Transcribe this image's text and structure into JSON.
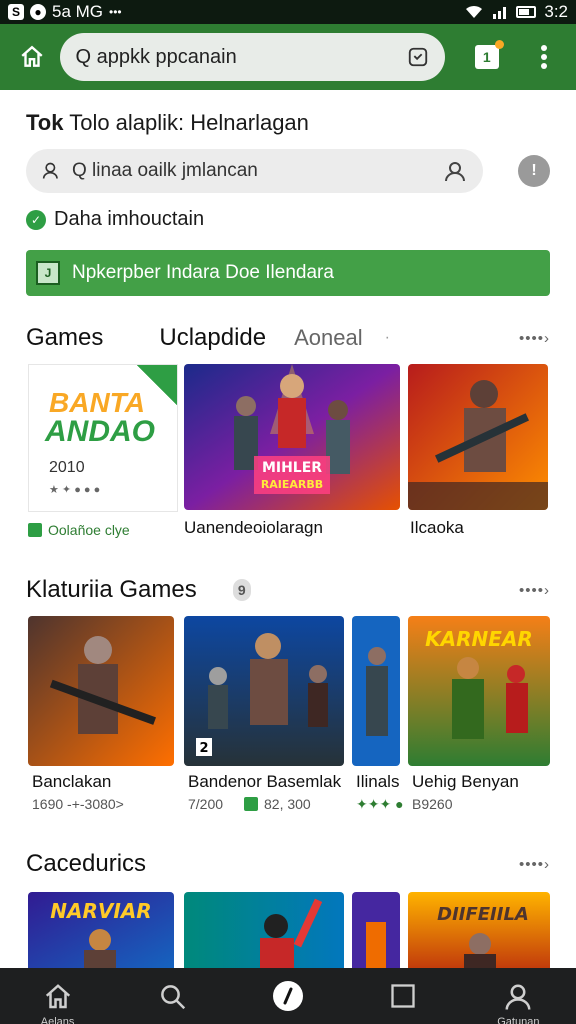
{
  "status_bar": {
    "left_text": "5a MG",
    "dots": "•••",
    "time": "3:2"
  },
  "browser": {
    "url": "Q appkk ppcanain"
  },
  "page": {
    "heading_bold": "Tok",
    "heading_rest": "Tolo alaplik: Helnarlagan",
    "search_placeholder": "Q linaa oailk jmlancan",
    "verify_text": "Daha imhouctain",
    "banner_text": "Npkerpber Indara Doe Ilendara"
  },
  "section1": {
    "title": "Games",
    "tab2": "Uclapdide",
    "tab3": "Aoneal",
    "more": "••••›",
    "ad": {
      "line1": "BANTA",
      "line2": "ANDAO",
      "year": "2010",
      "stars": "★ ✦ ● ● ●",
      "caption": "Oolañoe clye"
    },
    "cards": [
      {
        "caption": "Uanendeoiolaragn",
        "art_title": "MIHLER",
        "art_sub": "RAIEARBB"
      },
      {
        "caption": "Ilcaoka"
      }
    ]
  },
  "section2": {
    "title": "Klaturiia Games",
    "badge": "9",
    "more": "••••›",
    "cards": [
      {
        "caption": "Banclakan",
        "sub": "1690 -+-3080>"
      },
      {
        "caption": "Bandenor Basemlak",
        "sub": "7/200",
        "sub2": "82, 300",
        "badge": "2"
      },
      {
        "caption": "Ilinals",
        "sub": "✦✦✦ ●"
      },
      {
        "caption": "Uehig Benyan",
        "sub": "B9260",
        "art_title": "KARNEAR"
      }
    ]
  },
  "section3": {
    "title": "Cacedurics",
    "more": "••••›",
    "cards": [
      {
        "art_title": "NARVIAR"
      },
      {
        "art_title": ""
      },
      {
        "art_title": ""
      },
      {
        "art_title": "DIIFEIILA"
      }
    ]
  },
  "bottom_nav": [
    {
      "label": "Aelans",
      "icon": "home-icon"
    },
    {
      "label": "",
      "icon": "search-icon"
    },
    {
      "label": "",
      "icon": "compass-icon"
    },
    {
      "label": "",
      "icon": "square-icon"
    },
    {
      "label": "Gatunan",
      "icon": "account-icon"
    }
  ]
}
